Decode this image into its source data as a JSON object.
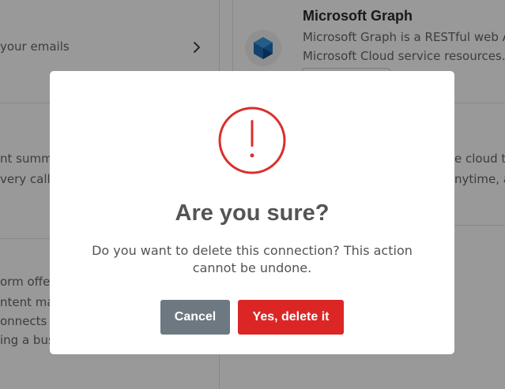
{
  "background": {
    "left_column": {
      "row1_text": "your emails",
      "row2_line1": "nt summa",
      "row2_line2": "very call",
      "row3_line1": "orm offer",
      "row3_line2": "ntent ma",
      "row3_line3": "onnects t",
      "row3_line4": "ing a bus"
    },
    "right_column": {
      "card_title": "Microsoft Graph",
      "card_desc_line1": "Microsoft Graph is a RESTful web AP",
      "card_desc_line2": "Microsoft Cloud service resources.",
      "row2_line1": "e cloud t",
      "row2_line2": "nytime, a"
    },
    "icons": {
      "chevron": "chevron-right-icon",
      "graph_logo": "microsoft-graph-logo"
    }
  },
  "modal": {
    "icon": "warning-exclamation-icon",
    "title": "Are you sure?",
    "message": "Do you want to delete this connection? This action cannot be undone.",
    "cancel_label": "Cancel",
    "confirm_label": "Yes, delete it"
  },
  "colors": {
    "danger": "#dc2626",
    "cancel": "#6e7881",
    "icon_red": "#d9302c",
    "text": "#545454",
    "overlay": "rgba(0,0,0,0.4)"
  }
}
